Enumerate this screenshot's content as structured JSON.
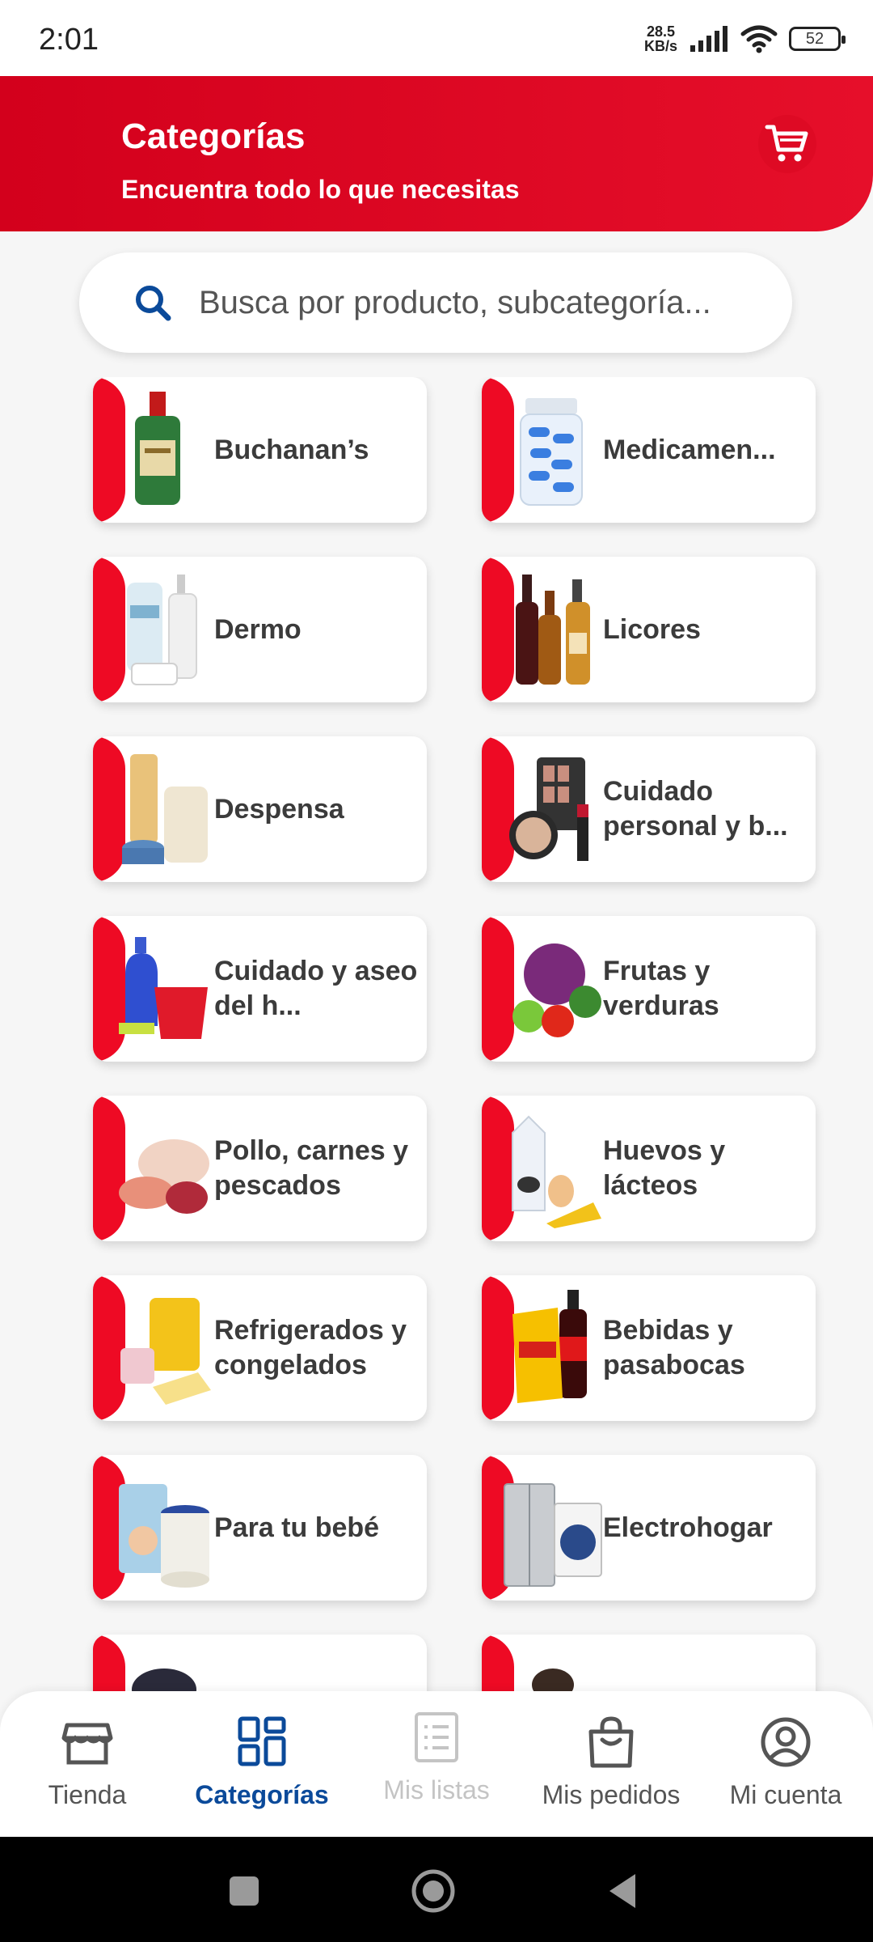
{
  "status_bar": {
    "time": "2:01",
    "net_speed_value": "28.5",
    "net_speed_unit": "KB/s",
    "battery": "52"
  },
  "header": {
    "title": "Categorías",
    "subtitle": "Encuentra todo lo que necesitas",
    "cart_icon": "cart-icon"
  },
  "search": {
    "placeholder": "Busca por producto, subcategoría..."
  },
  "categories": [
    {
      "label": "Buchanan’s",
      "icon": "whisky-bottle"
    },
    {
      "label": "Medicamen...",
      "icon": "pill-jar"
    },
    {
      "label": "Dermo",
      "icon": "cosmetic-bottles"
    },
    {
      "label": "Licores",
      "icon": "liquor-bottles"
    },
    {
      "label": "Despensa",
      "icon": "pantry-goods"
    },
    {
      "label": "Cuidado personal y b...",
      "icon": "makeup"
    },
    {
      "label": "Cuidado y aseo del h...",
      "icon": "cleaning-supplies"
    },
    {
      "label": "Frutas y verduras",
      "icon": "produce"
    },
    {
      "label": "Pollo, carnes y pescados",
      "icon": "meats"
    },
    {
      "label": "Huevos y lácteos",
      "icon": "dairy"
    },
    {
      "label": "Refrigerados y congelados",
      "icon": "frozen-food"
    },
    {
      "label": "Bebidas y pasabocas",
      "icon": "snacks-drinks"
    },
    {
      "label": "Para tu bebé",
      "icon": "baby-products"
    },
    {
      "label": "Electrohogar",
      "icon": "appliances"
    },
    {
      "label": "",
      "icon": "partial-item"
    },
    {
      "label": "",
      "icon": "partial-item"
    }
  ],
  "bottom_nav": [
    {
      "label": "Tienda",
      "icon": "store-icon",
      "state": "normal"
    },
    {
      "label": "Categorías",
      "icon": "grid-icon",
      "state": "active"
    },
    {
      "label": "Mis listas",
      "icon": "list-icon",
      "state": "disabled"
    },
    {
      "label": "Mis pedidos",
      "icon": "bag-icon",
      "state": "normal"
    },
    {
      "label": "Mi cuenta",
      "icon": "account-icon",
      "state": "normal"
    }
  ],
  "colors": {
    "brand_red": "#e60f2a",
    "active_blue": "#0b4a9a"
  }
}
